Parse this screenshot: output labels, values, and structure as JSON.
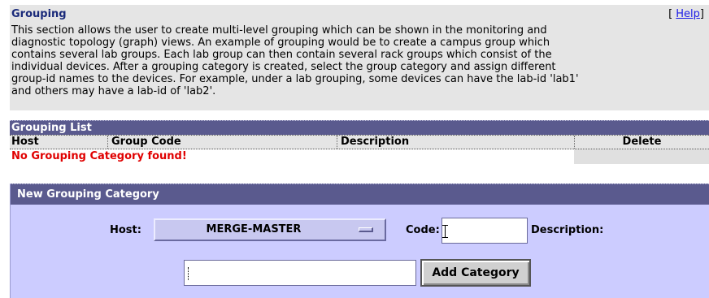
{
  "intro": {
    "title": "Grouping",
    "help_open": "[",
    "help_label": "Help",
    "help_close": "]",
    "lines": [
      "This section allows the user to create multi-level grouping which can be shown in the monitoring and",
      "diagnostic topology (graph) views. An example of grouping would be to create a campus group which",
      "contains several lab groups. Each lab group can then contain several rack groups which consist of the",
      "individual devices. After a grouping category is created, select the group category and assign different",
      "group-id names to the devices. For example, under a lab grouping, some devices can have the lab-id 'lab1'",
      "and others may have a lab-id of 'lab2'."
    ]
  },
  "grouping_list": {
    "title": "Grouping List",
    "columns": [
      "Host",
      "Group Code",
      "Description",
      "Delete"
    ],
    "empty_message": "No Grouping Category found!"
  },
  "new_category": {
    "title": "New Grouping Category",
    "host_label": "Host:",
    "host_value": "MERGE-MASTER",
    "code_label": "Code:",
    "code_value": "",
    "description_label": "Description:",
    "description_value": "",
    "add_button_label": "Add Category"
  },
  "colors": {
    "header_bar": "#5a5a8e",
    "panel_bg": "#ccccff",
    "intro_bg": "#e5e5e5",
    "error_text": "#e00000",
    "title_text": "#1a2a7a"
  }
}
